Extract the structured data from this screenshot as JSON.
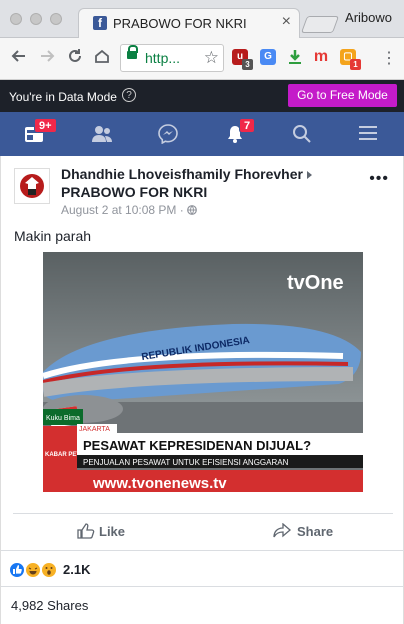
{
  "browser": {
    "tab_title": "PRABOWO FOR NKRI",
    "tab_favicon": "f",
    "tab_close": "×",
    "profile_name": "Aribowo",
    "url": "http...",
    "ext_badges": {
      "ublock": "3",
      "calendar": "1"
    },
    "ext_labels": {
      "m": "m"
    }
  },
  "data_mode": {
    "message": "You're in Data Mode",
    "help": "?",
    "button_label": "Go to Free Mode"
  },
  "nav": {
    "home_badge": "9+",
    "notifications_badge": "7"
  },
  "post": {
    "author": "Dhandhie Lhoveisfhamily Fhorevher",
    "page": "PRABOWO FOR NKRI",
    "timestamp": "August 2 at 10:08 PM · ",
    "more": "•••",
    "text": "Makin parah",
    "image": {
      "channel_logo": "tvOne",
      "plane_text": "REPUBLIK INDONESIA",
      "small_tag": "Kuku Bima",
      "kabar_petang": "KABAR PETANG",
      "location": "JAKARTA",
      "headline": "PESAWAT KEPRESIDENAN DIJUAL?",
      "subheadline": "PENJUALAN PESAWAT UNTUK EFISIENSI ANGGARAN",
      "website": "www.tvonenews.tv"
    },
    "like_label": "Like",
    "share_label": "Share",
    "reaction_count": "2.1K",
    "shares_count": "4,982 Shares"
  },
  "colors": {
    "facebook_blue": "#3b5998",
    "free_mode_magenta": "#c41bc9",
    "badge_red": "#f02849"
  }
}
